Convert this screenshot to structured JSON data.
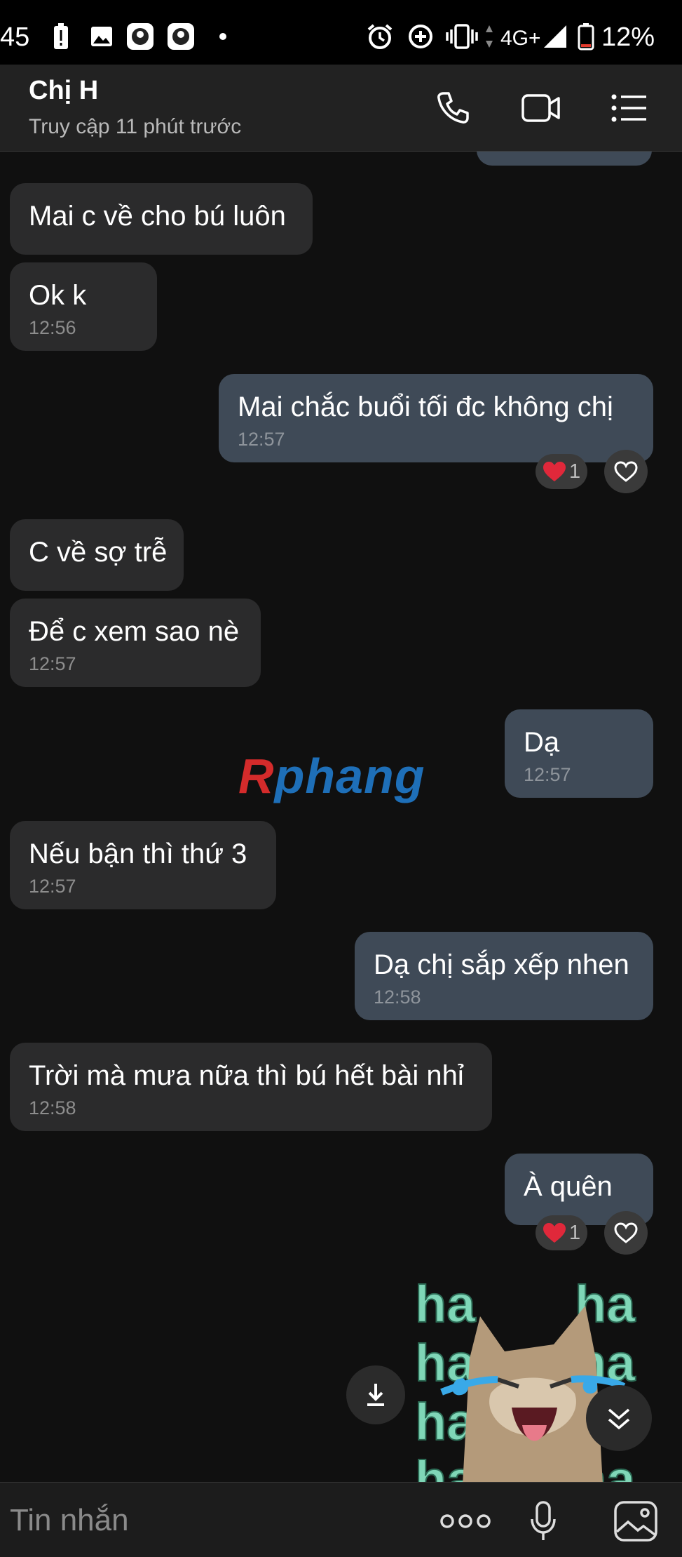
{
  "status_bar": {
    "time": "45",
    "network": "4G+",
    "battery": "12%"
  },
  "header": {
    "contact_name": "Chị H",
    "last_seen": "Truy cập 11 phút trước"
  },
  "messages": [
    {
      "dir": "in",
      "text": "Mai c về cho bú luôn",
      "time": ""
    },
    {
      "dir": "in",
      "text": "Ok k",
      "time": "12:56"
    },
    {
      "dir": "out",
      "text": "Mai chắc buổi tối đc không chị",
      "time": "12:57",
      "reaction": "1"
    },
    {
      "dir": "in",
      "text": "C về sợ trễ",
      "time": ""
    },
    {
      "dir": "in",
      "text": "Để c xem sao nè",
      "time": "12:57"
    },
    {
      "dir": "out",
      "text": "Dạ",
      "time": "12:57"
    },
    {
      "dir": "in",
      "text": "Nếu bận thì  thứ 3",
      "time": "12:57"
    },
    {
      "dir": "out",
      "text": "Dạ chị sắp xếp nhen",
      "time": "12:58"
    },
    {
      "dir": "in",
      "text": "Trời mà mưa nữa thì bú hết bài nhỉ",
      "time": "12:58"
    },
    {
      "dir": "out",
      "text": "À quên",
      "time": "",
      "reaction": "1"
    }
  ],
  "watermark": {
    "first": "R",
    "rest": "phang"
  },
  "sticker": {
    "text": "ha"
  },
  "input": {
    "placeholder": "Tin nhắn"
  },
  "colors": {
    "background": "#101010",
    "incoming_bubble": "#2b2b2c",
    "outgoing_bubble": "#3f4a57",
    "heart": "#e0283a"
  }
}
